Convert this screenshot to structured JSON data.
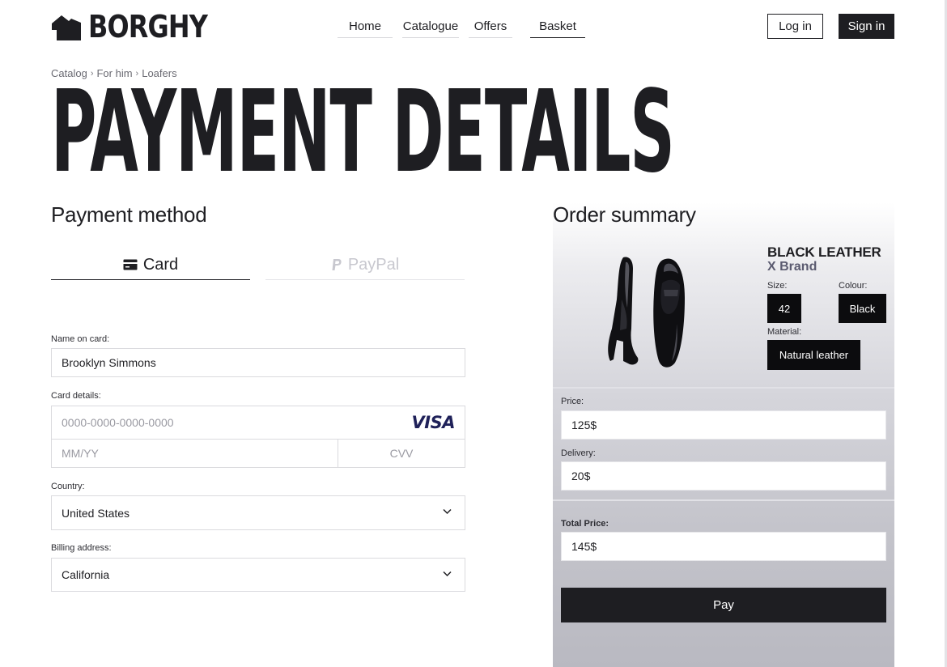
{
  "brand": {
    "name": "BORGHY"
  },
  "nav": {
    "items": [
      {
        "label": "Home",
        "active": false
      },
      {
        "label": "Catalogue",
        "active": false
      },
      {
        "label": "Offers",
        "active": false
      },
      {
        "label": "Basket",
        "active": true
      }
    ]
  },
  "auth": {
    "login_label": "Log in",
    "signin_label": "Sign in"
  },
  "breadcrumb": [
    "Catalog",
    "For him",
    "Loafers"
  ],
  "page_title": "PAYMENT DETAILS",
  "payment": {
    "heading": "Payment method",
    "tabs": [
      {
        "label": "Card",
        "active": true
      },
      {
        "label": "PayPal",
        "active": false
      }
    ],
    "name_label": "Name on card:",
    "name_value": "Brooklyn Simmons",
    "card_label": "Card details:",
    "card_number_placeholder": "0000-0000-0000-0000",
    "card_brand": "VISA",
    "expiry_placeholder": "MM/YY",
    "cvv_placeholder": "CVV",
    "country_label": "Country:",
    "country_value": "United States",
    "billing_label": "Billing address:",
    "billing_value": "California"
  },
  "summary": {
    "heading": "Order summary",
    "product": {
      "name": "BLACK LEATHER",
      "brand": "X Brand",
      "size_label": "Size:",
      "size": "42",
      "colour_label": "Colour:",
      "colour": "Black",
      "material_label": "Material:",
      "material": "Natural leather",
      "image_icon": "loafers-image"
    },
    "price_label": "Price:",
    "price": "125$",
    "delivery_label": "Delivery:",
    "delivery": "20$",
    "total_label": "Total Price:",
    "total": "145$",
    "pay_label": "Pay"
  },
  "colors": {
    "dark": "#1e1e22",
    "visa": "#1f2159",
    "brand_sub": "#5b5b70"
  }
}
